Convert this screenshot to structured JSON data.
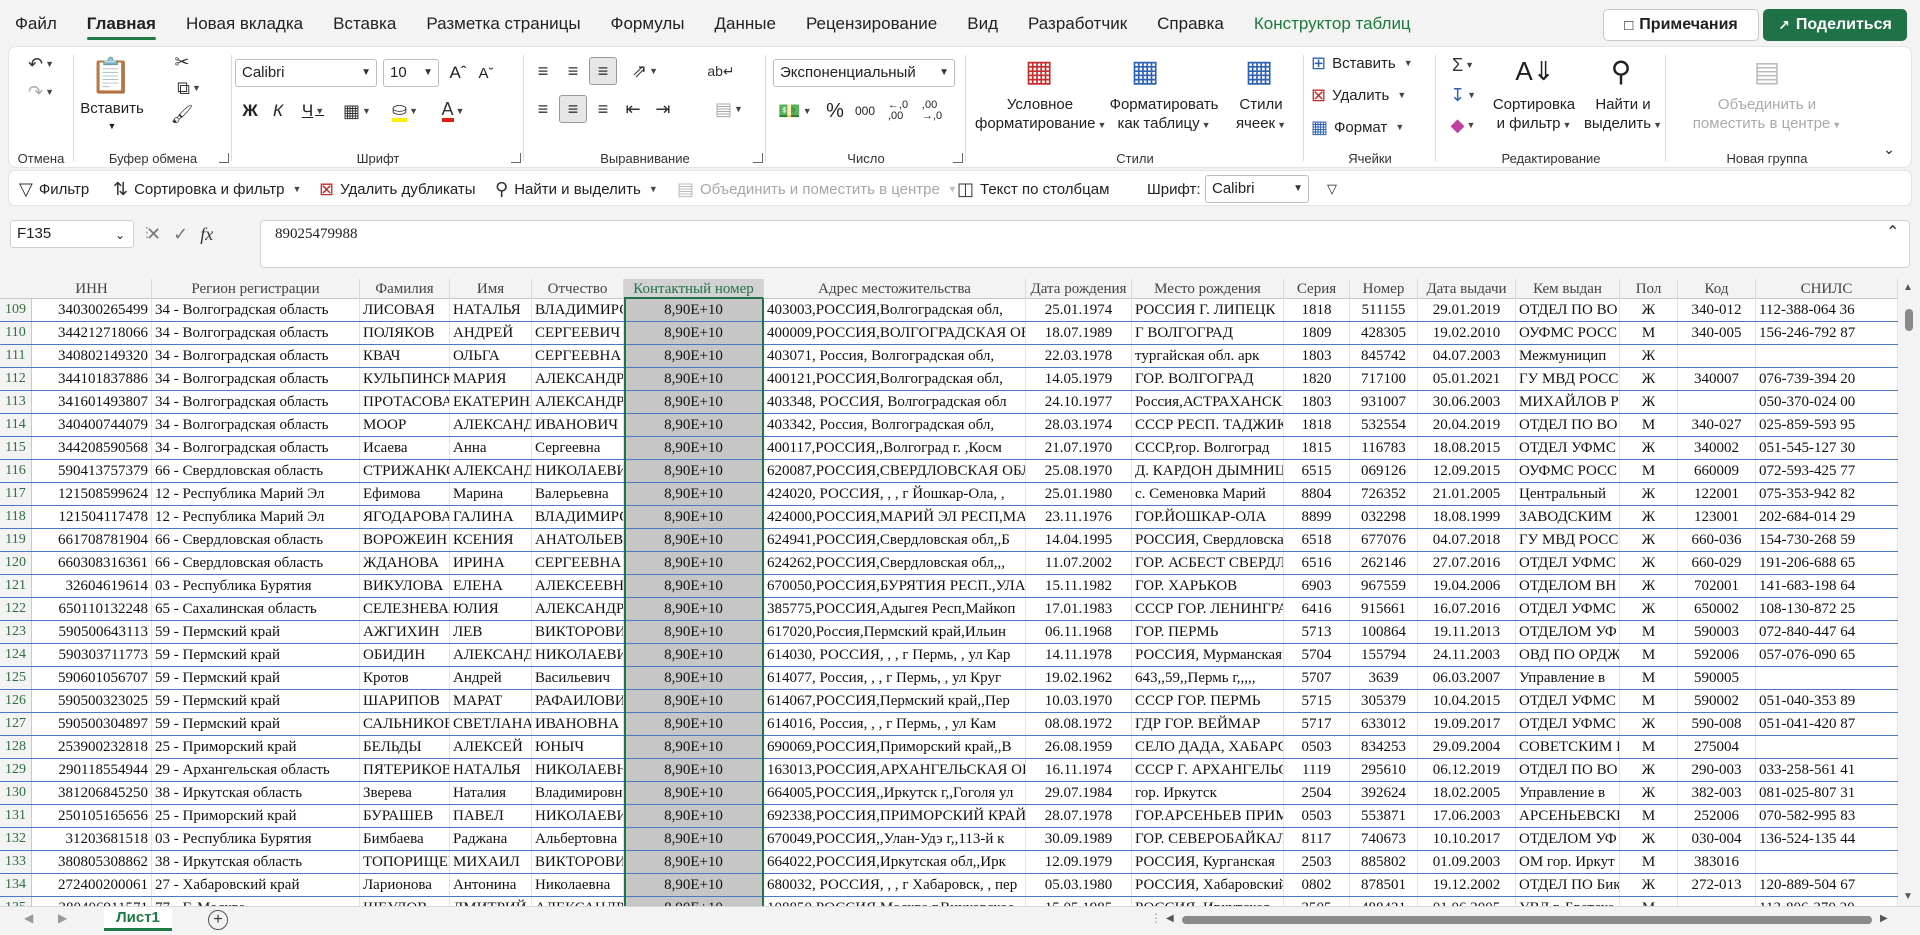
{
  "menu": {
    "tabs": [
      "Файл",
      "Главная",
      "Новая вкладка",
      "Вставка",
      "Разметка страницы",
      "Формулы",
      "Данные",
      "Рецензирование",
      "Вид",
      "Разработчик",
      "Справка",
      "Конструктор таблиц"
    ],
    "active_index": 1,
    "comments_label": "Примечания",
    "share_label": "Поделиться"
  },
  "ribbon": {
    "undo_group": "Отмена",
    "clipboard": {
      "label": "Буфер обмена",
      "paste": "Вставить"
    },
    "font": {
      "label": "Шрифт",
      "name": "Calibri",
      "size": "10"
    },
    "alignment": {
      "label": "Выравнивание"
    },
    "number": {
      "label": "Число",
      "format": "Экспоненциальный"
    },
    "styles": {
      "label": "Стили",
      "cond_format_1": "Условное",
      "cond_format_2": "форматирование",
      "format_table_1": "Форматировать",
      "format_table_2": "как таблицу",
      "cell_styles_1": "Стили",
      "cell_styles_2": "ячеек"
    },
    "cells": {
      "label": "Ячейки",
      "insert": "Вставить",
      "delete": "Удалить",
      "format": "Формат"
    },
    "editing": {
      "label": "Редактирование",
      "sort_1": "Сортировка",
      "sort_2": "и фильтр",
      "find_1": "Найти и",
      "find_2": "выделить"
    },
    "new_group": {
      "label": "Новая группа",
      "merge_1": "Объединить и",
      "merge_2": "поместить в центре"
    }
  },
  "quickbar": {
    "filter": "Фильтр",
    "sort_filter": "Сортировка и фильтр",
    "remove_dupes": "Удалить дубликаты",
    "find_select": "Найти и выделить",
    "merge_center": "Объединить и поместить в центре",
    "text_to_columns": "Текст по столбцам",
    "font_label": "Шрифт:",
    "font_value": "Calibri"
  },
  "formula_bar": {
    "name_box": "F135",
    "fx": "fx",
    "value": "89025479988"
  },
  "grid": {
    "headers": [
      "ИНН",
      "Регион регистрации",
      "Фамилия",
      "Имя",
      "Отчество",
      "Контактный номер",
      "Адрес местожительства",
      "Дата рождения",
      "Место рождения",
      "Серия",
      "Номер",
      "Дата выдачи",
      "Кем выдан",
      "Пол",
      "Код",
      "СНИЛС"
    ],
    "rows": [
      [
        "109",
        "340300265499",
        "34 - Волгоградская область",
        "ЛИСОВАЯ",
        "НАТАЛЬЯ",
        "ВЛАДИМИРОВНА",
        "8,90E+10",
        "403003,РОССИЯ,Волгоградская обл,",
        "25.01.1974",
        "РОССИЯ Г. ЛИПЕЦК",
        "1818",
        "511155",
        "29.01.2019",
        "ОТДЕЛ ПО ВО",
        "Ж",
        "340-012",
        "112-388-064 36"
      ],
      [
        "110",
        "344212718066",
        "34 - Волгоградская область",
        "ПОЛЯКОВ",
        "АНДРЕЙ",
        "СЕРГЕЕВИЧ",
        "8,90E+10",
        "400009,РОССИЯ,ВОЛГОГРАДСКАЯ ОБЛ",
        "18.07.1989",
        "Г ВОЛГОГРАД",
        "1809",
        "428305",
        "19.02.2010",
        "ОУФМС РОСС",
        "М",
        "340-005",
        "156-246-792 87"
      ],
      [
        "111",
        "340802149320",
        "34 - Волгоградская область",
        "КВАЧ",
        "ОЛЬГА",
        "СЕРГЕЕВНА",
        "8,90E+10",
        "403071, Россия, Волгоградская обл,",
        "22.03.1978",
        "тургайская обл. арк",
        "1803",
        "845742",
        "04.07.2003",
        "Межмуницип",
        "Ж",
        "",
        ""
      ],
      [
        "112",
        "344101837886",
        "34 - Волгоградская область",
        "КУЛЬПИНСКАЯ",
        "МАРИЯ",
        "АЛЕКСАНДРОВНА",
        "8,90E+10",
        "400121,РОССИЯ,Волгоградская обл,",
        "14.05.1979",
        "ГОР. ВОЛГОГРАД",
        "1820",
        "717100",
        "05.01.2021",
        "ГУ МВД РОСС",
        "Ж",
        "340007",
        "076-739-394 20"
      ],
      [
        "113",
        "341601493807",
        "34 - Волгоградская область",
        "ПРОТАСОВА",
        "ЕКАТЕРИНА",
        "АЛЕКСАНДРОВНА",
        "8,90E+10",
        "403348, РОССИЯ, Волгоградская обл",
        "24.10.1977",
        "Россия,АСТРАХАНСКАЯ",
        "1803",
        "931007",
        "30.06.2003",
        "МИХАЙЛОВ Р",
        "Ж",
        "",
        "050-370-024 00"
      ],
      [
        "114",
        "340400744079",
        "34 - Волгоградская область",
        "МООР",
        "АЛЕКСАНДР",
        "ИВАНОВИЧ",
        "8,90E+10",
        "403342, Россия, Волгоградская обл,",
        "28.03.1974",
        "СССР РЕСП. ТАДЖИКИСТАН",
        "1818",
        "532554",
        "20.04.2019",
        "ОТДЕЛ ПО ВО",
        "М",
        "340-027",
        "025-859-593 95"
      ],
      [
        "115",
        "344208590568",
        "34 - Волгоградская область",
        "Исаева",
        "Анна",
        "Сергеевна",
        "8,90E+10",
        "400117,РОССИЯ,,Волгоград г. ,Косм",
        "21.07.1970",
        "СССР,гор. Волгоград",
        "1815",
        "116783",
        "18.08.2015",
        "ОТДЕЛ УФМС",
        "Ж",
        "340002",
        "051-545-127 30"
      ],
      [
        "116",
        "590413757379",
        "66 - Свердловская область",
        "СТРИЖАНКОВ",
        "АЛЕКСАНДР",
        "НИКОЛАЕВИЧ",
        "8,90E+10",
        "620087,РОССИЯ,СВЕРДЛОВСКАЯ ОБЛ",
        "25.08.1970",
        "Д. КАРДОН ДЫМНИЦКОГО",
        "6515",
        "069126",
        "12.09.2015",
        "ОУФМС РОСС",
        "М",
        "660009",
        "072-593-425 77"
      ],
      [
        "117",
        "121508599624",
        "12 - Республика Марий Эл",
        "Ефимова",
        "Марина",
        "Валерьевна",
        "8,90E+10",
        "424020, РОССИЯ, , , г Йошкар-Ола, ,",
        "25.01.1980",
        "с. Семеновка Марий",
        "8804",
        "726352",
        "21.01.2005",
        "Центральный",
        "Ж",
        "122001",
        "075-353-942 82"
      ],
      [
        "118",
        "121504117478",
        "12 - Республика Марий Эл",
        "ЯГОДАРОВА",
        "ГАЛИНА",
        "ВЛАДИМИРОВНА",
        "8,90E+10",
        "424000,РОССИЯ,МАРИЙ ЭЛ РЕСП,МАРИ",
        "23.11.1976",
        "ГОР.ЙОШКАР-ОЛА",
        "8899",
        "032298",
        "18.08.1999",
        "ЗАВОДСКИМ",
        "Ж",
        "123001",
        "202-684-014 29"
      ],
      [
        "119",
        "661708781904",
        "66 - Свердловская область",
        "ВОРОЖЕИН",
        "КСЕНИЯ",
        "АНАТОЛЬЕВНА",
        "8,90E+10",
        "624941,РОССИЯ,Свердловская обл,,Б",
        "14.04.1995",
        "РОССИЯ, Свердловская",
        "6518",
        "677076",
        "04.07.2018",
        "ГУ МВД РОСС",
        "Ж",
        "660-036",
        "154-730-268 59"
      ],
      [
        "120",
        "660308316361",
        "66 - Свердловская область",
        "ЖДАНОВА",
        "ИРИНА",
        "СЕРГЕЕВНА",
        "8,90E+10",
        "624262,РОССИЯ,Свердловская обл,,,",
        "11.07.2002",
        "ГОР. АСБЕСТ СВЕРДЛОВСКОЙ",
        "6516",
        "262146",
        "27.07.2016",
        "ОТДЕЛ УФМС",
        "Ж",
        "660-029",
        "191-206-688 65"
      ],
      [
        "121",
        "32604619614",
        "03 - Республика Бурятия",
        "ВИКУЛОВА",
        "ЕЛЕНА",
        "АЛЕКСЕЕВНА",
        "8,90E+10",
        "670050,РОССИЯ,БУРЯТИЯ РЕСП.,УЛАН",
        "15.11.1982",
        "ГОР. ХАРЬКОВ",
        "6903",
        "967559",
        "19.04.2006",
        "ОТДЕЛОМ ВН",
        "Ж",
        "702001",
        "141-683-198 64"
      ],
      [
        "122",
        "650110132248",
        "65 - Сахалинская область",
        "СЕЛЕЗНЕВА",
        "ЮЛИЯ",
        "АЛЕКСАНДРОВНА",
        "8,90E+10",
        "385775,РОССИЯ,Адыгея Респ,Майкоп",
        "17.01.1983",
        "СССР ГОР. ЛЕНИНГРАД",
        "6416",
        "915661",
        "16.07.2016",
        "ОТДЕЛ УФМС",
        "Ж",
        "650002",
        "108-130-872 25"
      ],
      [
        "123",
        "590500643113",
        "59 - Пермский край",
        "АЖГИХИН",
        "ЛЕВ",
        "ВИКТОРОВИЧ",
        "8,90E+10",
        "617020,Россия,Пермский край,Ильин",
        "06.11.1968",
        "ГОР. ПЕРМЬ",
        "5713",
        "100864",
        "19.11.2013",
        "ОТДЕЛОМ УФ",
        "М",
        "590003",
        "072-840-447 64"
      ],
      [
        "124",
        "590303711773",
        "59 - Пермский край",
        "ОБИДИН",
        "АЛЕКСАНДР",
        "НИКОЛАЕВИЧ",
        "8,90E+10",
        "614030, РОССИЯ, , , г Пермь, , ул Кар",
        "14.11.1978",
        "РОССИЯ, Мурманская",
        "5704",
        "155794",
        "24.11.2003",
        "ОВД ПО ОРДЖ",
        "М",
        "592006",
        "057-076-090 65"
      ],
      [
        "125",
        "590601056707",
        "59 - Пермский край",
        "Кротов",
        "Андрей",
        "Васильевич",
        "8,90E+10",
        "614077, Россия, , , г Пермь, , ул Круг",
        "19.02.1962",
        "643,,59,,Пермь г,,,,,",
        "5707",
        "3639",
        "06.03.2007",
        "Управление в",
        "М",
        "590005",
        ""
      ],
      [
        "126",
        "590500323025",
        "59 - Пермский край",
        "ШАРИПОВ",
        "МАРАТ",
        "РАФАИЛОВИЧ",
        "8,90E+10",
        "614067,РОССИЯ,Пермский край,,Пер",
        "10.03.1970",
        "СССР ГОР. ПЕРМЬ",
        "5715",
        "305379",
        "10.04.2015",
        "ОТДЕЛ УФМС",
        "М",
        "590002",
        "051-040-353 89"
      ],
      [
        "127",
        "590500304897",
        "59 - Пермский край",
        "САЛЬНИКОВА",
        "СВЕТЛАНА",
        "ИВАНОВНА",
        "8,90E+10",
        "614016, Россия, , , г Пермь, , ул Кам",
        "08.08.1972",
        "ГДР ГОР. ВЕЙМАР",
        "5717",
        "633012",
        "19.09.2017",
        "ОТДЕЛ УФМС",
        "Ж",
        "590-008",
        "051-041-420 87"
      ],
      [
        "128",
        "253900232818",
        "25 - Приморский край",
        "БЕЛЬДЫ",
        "АЛЕКСЕЙ",
        "ЮНЫЧ",
        "8,90E+10",
        "690069,РОССИЯ,Приморский край,,В",
        "26.08.1959",
        "СЕЛО ДАДА, ХАБАРОВСКОГО",
        "0503",
        "834253",
        "29.09.2004",
        "СОВЕТСКИМ Р",
        "М",
        "275004",
        ""
      ],
      [
        "129",
        "290118554944",
        "29 - Архангельская область",
        "ПЯТЕРИКОВА",
        "НАТАЛЬЯ",
        "НИКОЛАЕВНА",
        "8,90E+10",
        "163013,РОССИЯ,АРХАНГЕЛЬСКАЯ ОБЛ",
        "16.11.1974",
        "СССР Г. АРХАНГЕЛЬСК",
        "1119",
        "295610",
        "06.12.2019",
        "ОТДЕЛ ПО ВО",
        "Ж",
        "290-003",
        "033-258-561 41"
      ],
      [
        "130",
        "381206845250",
        "38 - Иркутская область",
        "Зверева",
        "Наталия",
        "Владимировна",
        "8,90E+10",
        "664005,РОССИЯ,,Иркутск г,,Гоголя ул",
        "29.07.1984",
        "гор. Иркутск",
        "2504",
        "392624",
        "18.02.2005",
        "Управление в",
        "Ж",
        "382-003",
        "081-025-807 31"
      ],
      [
        "131",
        "250105165656",
        "25 - Приморский край",
        "БУРАШЕВ",
        "ПАВЕЛ",
        "НИКОЛАЕВИЧ",
        "8,90E+10",
        "692338,РОССИЯ,ПРИМОРСКИЙ КРАЙ",
        "28.07.1978",
        "ГОР.АРСЕНЬЕВ ПРИМОРСКОГО",
        "0503",
        "553871",
        "17.06.2003",
        "АРСЕНЬЕВСКИ",
        "М",
        "252006",
        "070-582-995 83"
      ],
      [
        "132",
        "31203681518",
        "03 - Республика Бурятия",
        "Бимбаева",
        "Раджана",
        "Альбертовна",
        "8,90E+10",
        "670049,РОССИЯ,,Улан-Удэ г,,113-й к",
        "30.09.1989",
        "ГОР. СЕВЕРОБАЙКАЛЬСК",
        "8117",
        "740673",
        "10.10.2017",
        "ОТДЕЛОМ УФ",
        "Ж",
        "030-004",
        "136-524-135 44"
      ],
      [
        "133",
        "380805308862",
        "38 - Иркутская область",
        "ТОПОРИЩЕВ",
        "МИХАИЛ",
        "ВИКТОРОВИЧ",
        "8,90E+10",
        "664022,РОССИЯ,Иркутская обл,,Ирк",
        "12.09.1979",
        "РОССИЯ, Курганская",
        "2503",
        "885802",
        "01.09.2003",
        "ОМ гор. Иркут",
        "М",
        "383016",
        ""
      ],
      [
        "134",
        "272400200061",
        "27 - Хабаровский край",
        "Ларионова",
        "Антонина",
        "Николаевна",
        "8,90E+10",
        "680032, РОССИЯ, , , г Хабаровск, , пер",
        "05.03.1980",
        "РОССИЯ, Хабаровский",
        "0802",
        "878501",
        "19.12.2002",
        "ОТДЕЛ ПО Бикина",
        "Ж",
        "272-013",
        "120-889-504 67"
      ],
      [
        "135",
        "380406911571",
        "77 - Г. Москва",
        "ШЕУЛОВ",
        "ДМИТРИЙ",
        "АЛЕКСАНДРОВИЧ",
        "8,90E+10",
        "108850,РОССИЯ,Москва г,Внуковское",
        "15.05.1985",
        "РОССИЯ, Иркутская",
        "2505",
        "488421",
        "01.06.2005",
        "УВД г. Братска",
        "М",
        "",
        "113-806-270 20"
      ]
    ]
  },
  "sheet": {
    "tab_name": "Лист1"
  },
  "colors": {
    "accent": "#217346",
    "selection": "#c6c6c6",
    "row_border": "#4a77c6"
  }
}
